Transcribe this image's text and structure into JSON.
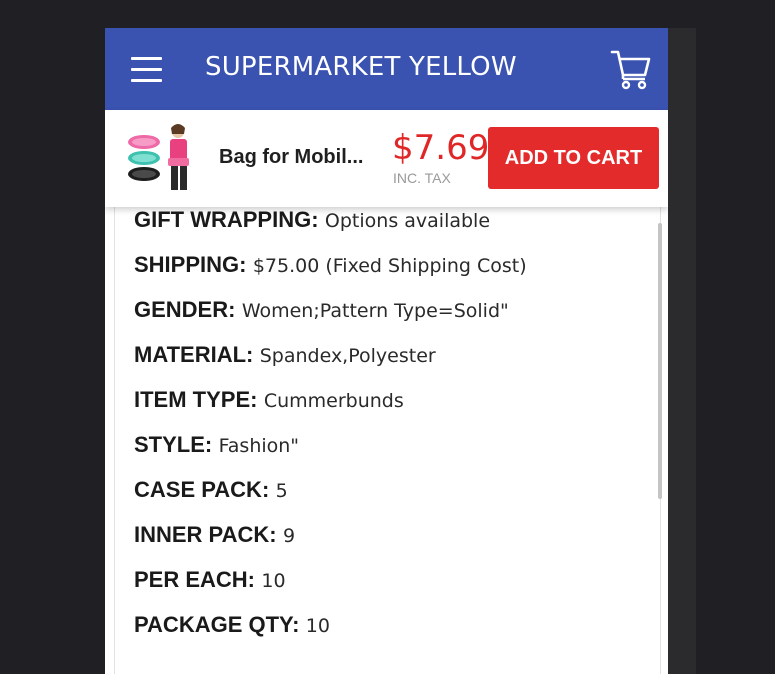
{
  "header": {
    "store_title": "SUPERMARKET YELLOW",
    "menu_icon": "hamburger-menu-icon",
    "cart_icon": "shopping-cart-icon"
  },
  "product_bar": {
    "name": "Bag for Mobil...",
    "price": "$7.69",
    "tax_note": "INC. TAX",
    "add_to_cart_label": "ADD TO CART"
  },
  "specs": [
    {
      "key": "GIFT WRAPPING:",
      "value": "Options available"
    },
    {
      "key": "SHIPPING:",
      "value": "$75.00 (Fixed Shipping Cost)"
    },
    {
      "key": "GENDER:",
      "value": "Women;Pattern Type=Solid\""
    },
    {
      "key": "MATERIAL:",
      "value": "Spandex,Polyester"
    },
    {
      "key": "ITEM TYPE:",
      "value": "Cummerbunds"
    },
    {
      "key": "STYLE:",
      "value": "Fashion\""
    },
    {
      "key": "CASE PACK:",
      "value": "5"
    },
    {
      "key": "INNER PACK:",
      "value": "9"
    },
    {
      "key": "PER EACH:",
      "value": "10"
    },
    {
      "key": "PACKAGE QTY:",
      "value": "10"
    }
  ],
  "colors": {
    "header_bg": "#3a52b0",
    "price": "#e02727",
    "add_to_cart_bg": "#e42b2b",
    "page_bg": "#202024"
  }
}
